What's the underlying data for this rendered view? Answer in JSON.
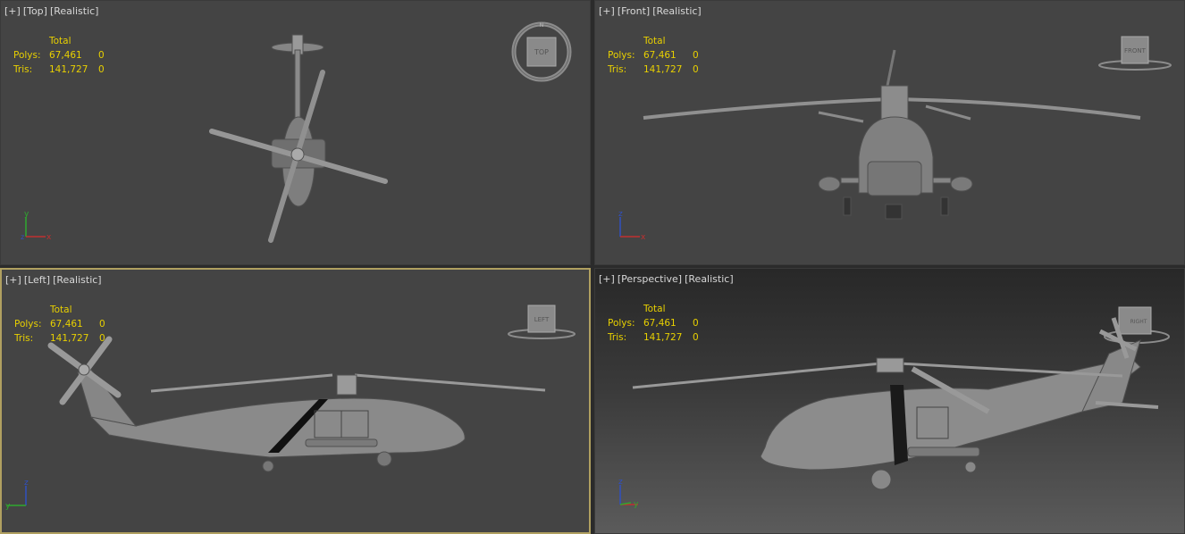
{
  "viewports": {
    "top": {
      "plus": "[+]",
      "view": "[Top]",
      "shading": "[Realistic]",
      "cube": "TOP"
    },
    "front": {
      "plus": "[+]",
      "view": "[Front]",
      "shading": "[Realistic]",
      "cube": "FRONT"
    },
    "left": {
      "plus": "[+]",
      "view": "[Left]",
      "shading": "[Realistic]",
      "cube": "LEFT"
    },
    "perspective": {
      "plus": "[+]",
      "view": "[Perspective]",
      "shading": "[Realistic]",
      "cube": "RIGHT"
    }
  },
  "stats": {
    "header": "Total",
    "polys_label": "Polys:",
    "polys_value": "67,461",
    "polys_selected": "0",
    "tris_label": "Tris:",
    "tris_value": "141,727",
    "tris_selected": "0"
  },
  "axes": {
    "x": "x",
    "y": "y",
    "z": "z"
  },
  "colors": {
    "stats_text": "#e8d000",
    "active_border": "#b0a060",
    "viewport_bg": "#444444"
  }
}
